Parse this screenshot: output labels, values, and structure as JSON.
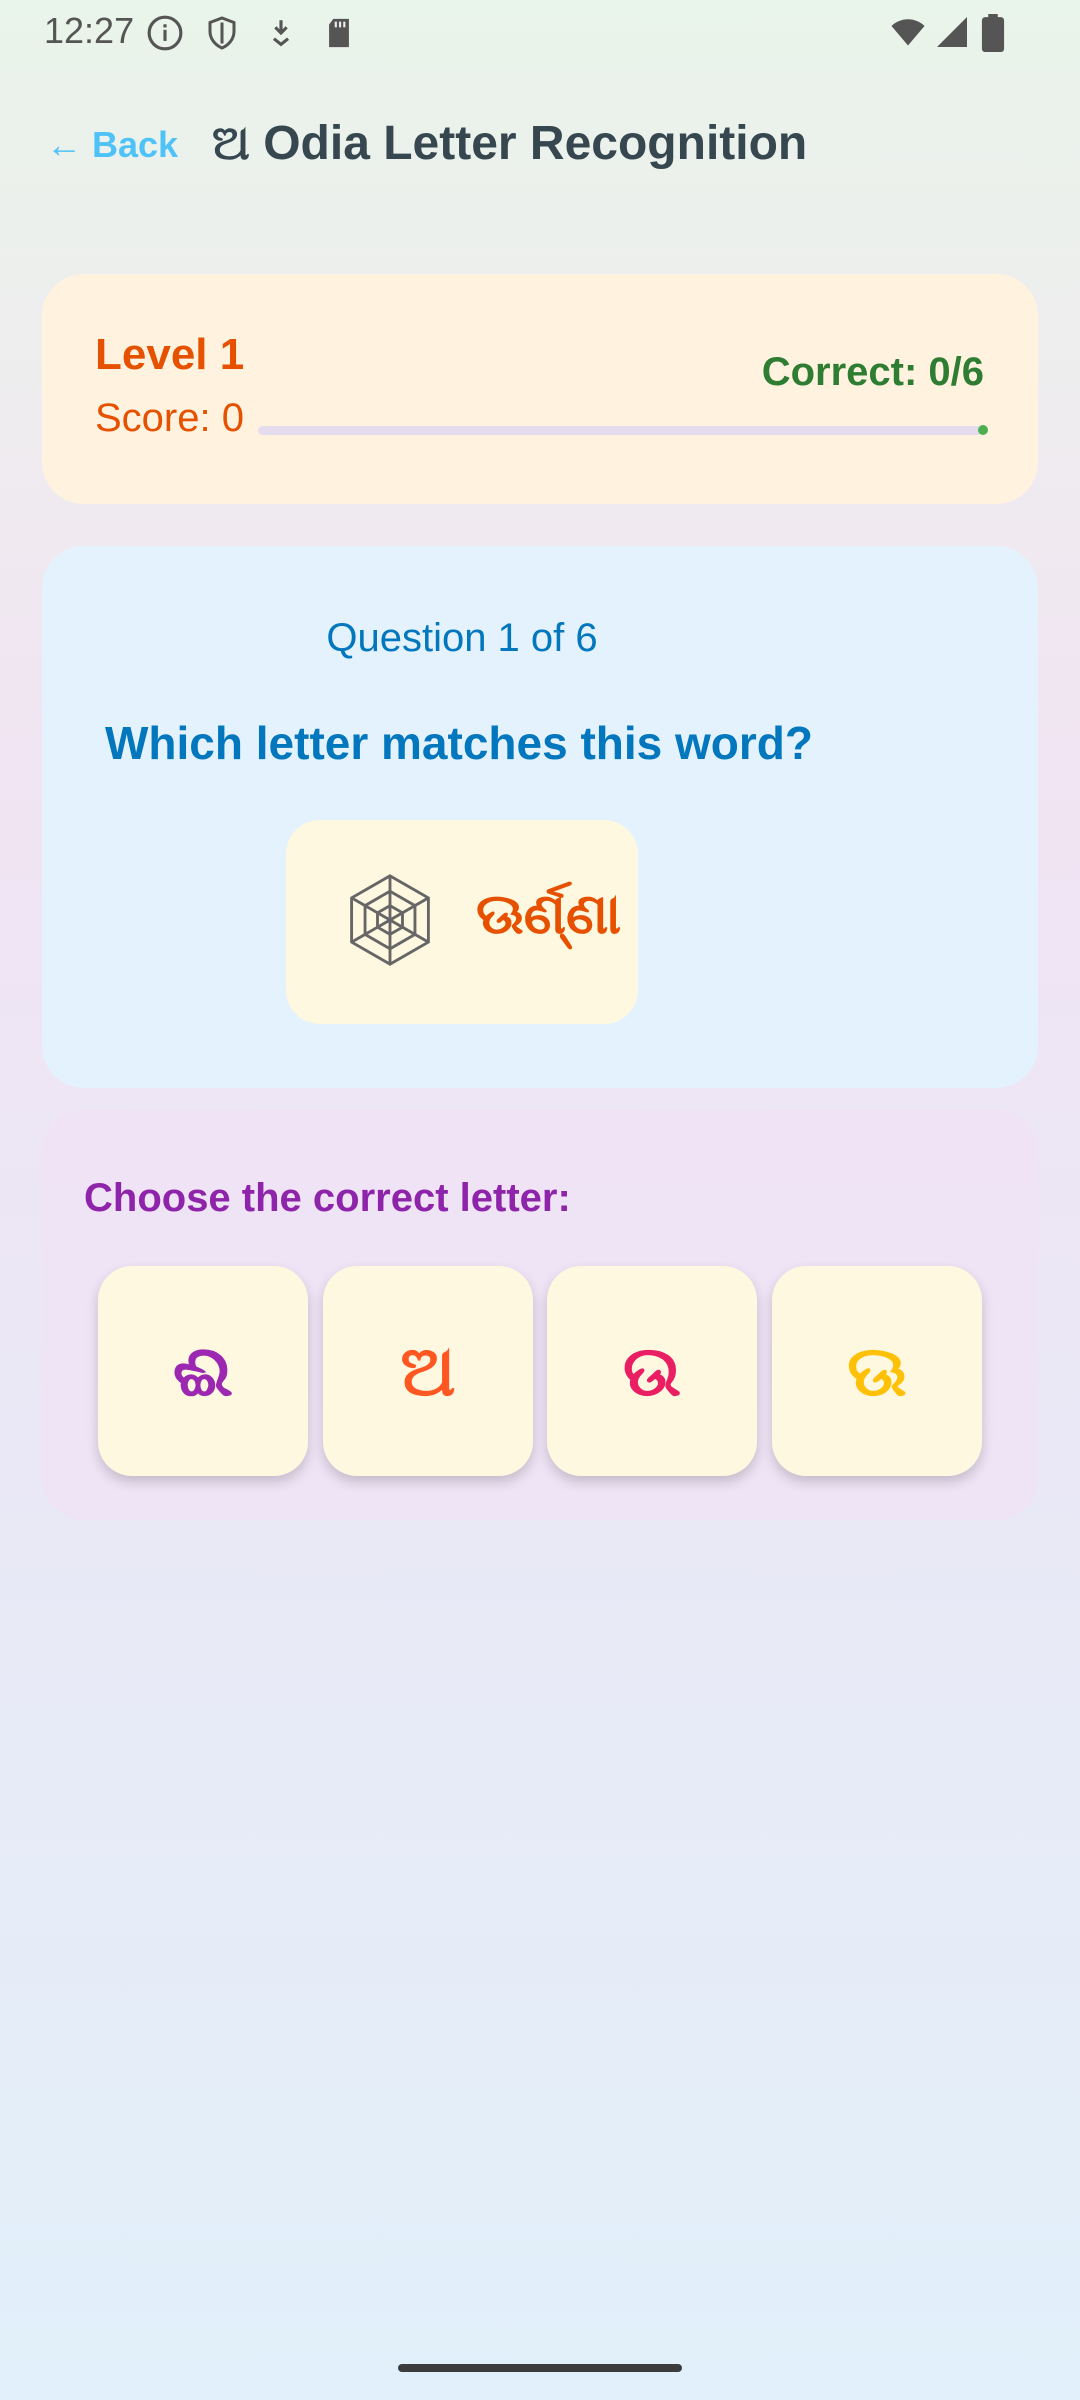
{
  "status_bar": {
    "time": "12:27",
    "left_icons": [
      "info-icon",
      "shield-icon",
      "download-icon",
      "sd-card-icon"
    ],
    "right_icons": [
      "wifi-icon",
      "signal-icon",
      "battery-icon"
    ]
  },
  "header": {
    "back_label": "← Back",
    "title": "ଅ Odia Letter Recognition"
  },
  "score_card": {
    "level": "Level 1",
    "score": "Score: 0",
    "correct": "Correct: 0/6",
    "progress_fraction": 0
  },
  "question": {
    "counter": "Question 1 of 6",
    "prompt": "Which letter matches this word?",
    "word_icon": "spider-web-icon",
    "word": "ଊର୍ଣ୍ଣା"
  },
  "choices": {
    "label": "Choose the correct letter:",
    "options": [
      {
        "letter": "ଈ",
        "color": "#9c27b0"
      },
      {
        "letter": "ଅ",
        "color": "#ff5722"
      },
      {
        "letter": "ଉ",
        "color": "#e91e63"
      },
      {
        "letter": "ଊ",
        "color": "#ffc107"
      }
    ]
  },
  "colors": {
    "accent_back": "#4fc3f7",
    "level_orange": "#e65100",
    "correct_green": "#2e7d32",
    "question_blue": "#0277bd",
    "choose_purple": "#8e24aa"
  }
}
